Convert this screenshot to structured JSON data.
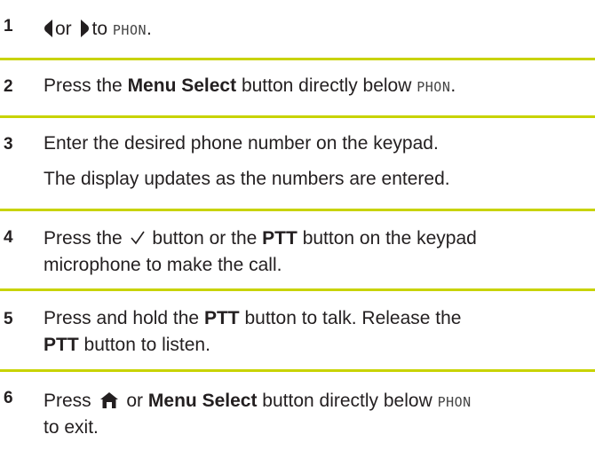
{
  "accent_color": "#c8d300",
  "steps": [
    {
      "number": "1",
      "lines": [
        {
          "icon_left": "left-arrow-icon",
          "or": "or",
          "icon_right": "right-arrow-icon",
          "to": "to",
          "menu": "PHON",
          "end": "."
        }
      ]
    },
    {
      "number": "2",
      "text_a": "Press the",
      "bold_a": "Menu Select",
      "text_b": "button directly below",
      "menu": "PHON",
      "end": "."
    },
    {
      "number": "3",
      "line1": "Enter the desired phone number on the keypad.",
      "line2": "The display updates as the numbers are entered."
    },
    {
      "number": "4",
      "text_a": "Press the",
      "icon": "check-icon",
      "text_b": "button or the",
      "bold_a": "PTT",
      "text_c": "button on the keypad",
      "line2": "microphone to make the call."
    },
    {
      "number": "5",
      "text_a": "Press and hold the",
      "bold_a": "PTT",
      "text_b": "button to talk. Release the",
      "bold_b": "PTT",
      "text_c": "button to listen."
    },
    {
      "number": "6",
      "text_a": "Press",
      "icon": "home-icon",
      "text_b": "or",
      "bold_a": "Menu Select",
      "text_c": "button directly below",
      "menu": "PHON",
      "line2": "to exit."
    }
  ]
}
